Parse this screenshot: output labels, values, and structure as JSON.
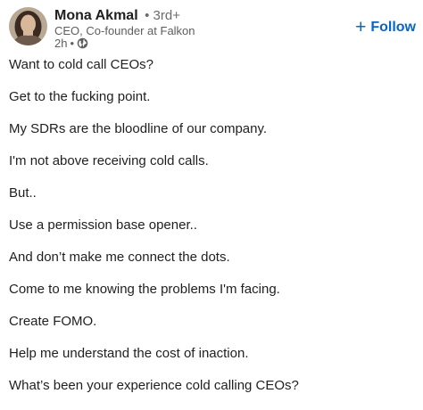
{
  "author": {
    "name": "Mona Akmal",
    "degree": "• 3rd+",
    "headline": "CEO, Co-founder at Falkon",
    "time": "2h",
    "separator": "•",
    "visibility_icon": "globe-icon"
  },
  "follow": {
    "plus": "+",
    "label": "Follow",
    "color": "#0a66c2"
  },
  "post": {
    "lines": [
      "Want to cold call CEOs?",
      "Get to the fucking point.",
      "My SDRs are the bloodline of our company.",
      "I'm not above receiving cold calls.",
      "But..",
      "Use a permission base opener..",
      "And don’t make me connect the dots.",
      "Come to me knowing the problems I'm facing.",
      "Create FOMO.",
      "Help me understand the cost of inaction.",
      "What’s been your experience cold calling CEOs?"
    ]
  }
}
